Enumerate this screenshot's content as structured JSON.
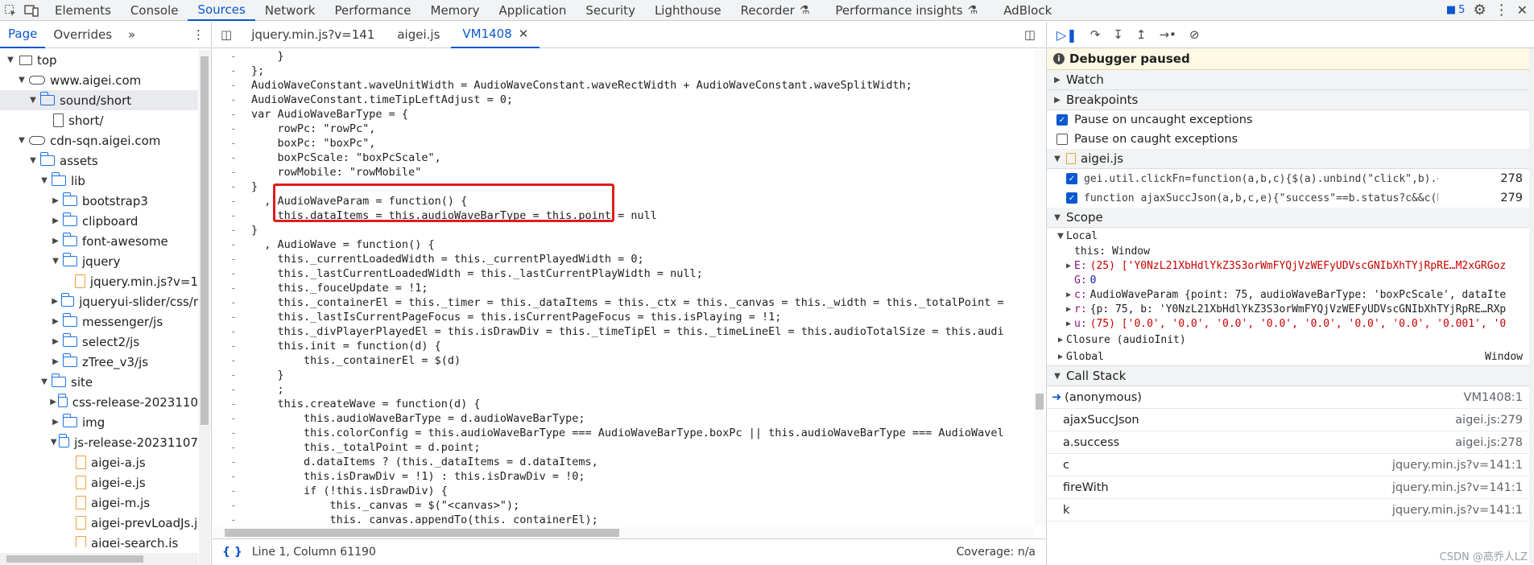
{
  "toolbar": {
    "tabs": [
      "Elements",
      "Console",
      "Sources",
      "Network",
      "Performance",
      "Memory",
      "Application",
      "Security",
      "Lighthouse",
      "Recorder",
      "Performance insights",
      "AdBlock"
    ],
    "active_tab": "Sources",
    "issues_count": "5"
  },
  "navigator": {
    "tabs": [
      "Page",
      "Overrides"
    ],
    "tree": [
      {
        "label": "top",
        "depth": 0,
        "type": "frame",
        "open": true
      },
      {
        "label": "www.aigei.com",
        "depth": 1,
        "type": "cloud",
        "open": true
      },
      {
        "label": "sound/short",
        "depth": 2,
        "type": "folder",
        "open": true,
        "selected": true
      },
      {
        "label": "short/",
        "depth": 3,
        "type": "file"
      },
      {
        "label": "cdn-sqn.aigei.com",
        "depth": 1,
        "type": "cloud",
        "open": true
      },
      {
        "label": "assets",
        "depth": 2,
        "type": "folder",
        "open": true
      },
      {
        "label": "lib",
        "depth": 3,
        "type": "folder",
        "open": true
      },
      {
        "label": "bootstrap3",
        "depth": 4,
        "type": "folder",
        "open": false
      },
      {
        "label": "clipboard",
        "depth": 4,
        "type": "folder",
        "open": false
      },
      {
        "label": "font-awesome",
        "depth": 4,
        "type": "folder",
        "open": false
      },
      {
        "label": "jquery",
        "depth": 4,
        "type": "folder",
        "open": true
      },
      {
        "label": "jquery.min.js?v=1",
        "depth": 5,
        "type": "jsfile"
      },
      {
        "label": "jqueryui-slider/css/r",
        "depth": 4,
        "type": "folder",
        "open": false
      },
      {
        "label": "messenger/js",
        "depth": 4,
        "type": "folder",
        "open": false
      },
      {
        "label": "select2/js",
        "depth": 4,
        "type": "folder",
        "open": false
      },
      {
        "label": "zTree_v3/js",
        "depth": 4,
        "type": "folder",
        "open": false
      },
      {
        "label": "site",
        "depth": 3,
        "type": "folder",
        "open": true
      },
      {
        "label": "css-release-2023110",
        "depth": 4,
        "type": "folder",
        "open": false
      },
      {
        "label": "img",
        "depth": 4,
        "type": "folder",
        "open": false
      },
      {
        "label": "js-release-20231107",
        "depth": 4,
        "type": "folder",
        "open": true
      },
      {
        "label": "aigei-a.js",
        "depth": 5,
        "type": "jsfile"
      },
      {
        "label": "aigei-e.js",
        "depth": 5,
        "type": "jsfile"
      },
      {
        "label": "aigei-m.js",
        "depth": 5,
        "type": "jsfile"
      },
      {
        "label": "aigei-prevLoadJs.j",
        "depth": 5,
        "type": "jsfile"
      },
      {
        "label": "aigei-search.js",
        "depth": 5,
        "type": "jsfile"
      }
    ]
  },
  "editor": {
    "tabs": [
      "jquery.min.js?v=141",
      "aigei.js",
      "VM1408"
    ],
    "active_tab": "VM1408",
    "lines": [
      "    }",
      "};",
      "AudioWaveConstant.waveUnitWidth = AudioWaveConstant.waveRectWidth + AudioWaveConstant.waveSplitWidth;",
      "AudioWaveConstant.timeTipLeftAdjust = 0;",
      "var AudioWaveBarType = {",
      "    rowPc: \"rowPc\",",
      "    boxPc: \"boxPc\",",
      "    boxPcScale: \"boxPcScale\",",
      "    rowMobile: \"rowMobile\"",
      "}",
      "  , AudioWaveParam = function() {",
      "    this.dataItems = this.audioWaveBarType = this.point = null",
      "}",
      "  , AudioWave = function() {",
      "    this._currentLoadedWidth = this._currentPlayedWidth = 0;",
      "    this._lastCurrentLoadedWidth = this._lastCurrentPlayWidth = null;",
      "    this._fouceUpdate = !1;",
      "    this._containerEl = this._timer = this._dataItems = this._ctx = this._canvas = this._width = this._totalPoint =",
      "    this._lastIsCurrentPageFocus = this.isCurrentPageFocus = this.isPlaying = !1;",
      "    this._divPlayerPlayedEl = this.isDrawDiv = this._timeTipEl = this._timeLineEl = this.audioTotalSize = this.audi",
      "    this.init = function(d) {",
      "        this._containerEl = $(d)",
      "    }",
      "    ;",
      "    this.createWave = function(d) {",
      "        this.audioWaveBarType = d.audioWaveBarType;",
      "        this.colorConfig = this.audioWaveBarType === AudioWaveBarType.boxPc || this.audioWaveBarType === AudioWavel",
      "        this._totalPoint = d.point;",
      "        d.dataItems ? (this._dataItems = d.dataItems,",
      "        this.isDrawDiv = !1) : this.isDrawDiv = !0;",
      "        if (!this.isDrawDiv) {",
      "            this._canvas = $(\"<canvas>\");",
      "            this._canvas.appendTo(this._containerEl);"
    ],
    "status_position": "Line 1, Column 61190",
    "coverage": "Coverage: n/a"
  },
  "debugger": {
    "paused_label": "Debugger paused",
    "sections": {
      "watch": "Watch",
      "breakpoints": "Breakpoints",
      "scope": "Scope",
      "call_stack": "Call Stack"
    },
    "pause_uncaught": "Pause on uncaught exceptions",
    "pause_caught": "Pause on caught exceptions",
    "bp_file": "aigei.js",
    "breakpoints": [
      {
        "code": "gei.util.clickFn=function(a,b,c){$(a).unbind(\"click\",b).cli…",
        "line": "278"
      },
      {
        "code": "function ajaxSuccJson(a,b,c,e){\"success\"==b.status?c&&c(b):…",
        "line": "279"
      }
    ],
    "scope": {
      "local_label": "Local",
      "this_row": "this: Window",
      "E_key": "E:",
      "E_val": "(25) ['Y0NzL21XbHdlYkZ3S3orWmFYQjVzWEFyUDVscGNIbXhTYjRpRE…M2xGRGoz",
      "G_key": "G:",
      "G_val": "0",
      "c_key": "c:",
      "c_val": "AudioWaveParam {point: 75, audioWaveBarType: 'boxPcScale', dataIte",
      "r_key": "r:",
      "r_val": "{p: 75, b: 'Y0NzL21XbHdlYkZ3S3orWmFYQjVzWEFyUDVscGNIbXhTYjRpRE…RXp",
      "u_key": "u:",
      "u_val": "(75) ['0.0', '0.0', '0.0', '0.0', '0.0', '0.0', '0.0', '0.001', '0",
      "closure": "Closure (audioInit)",
      "global": "Global",
      "global_val": "Window"
    },
    "call_stack": [
      {
        "name": "(anonymous)",
        "loc": "VM1408:1",
        "current": true
      },
      {
        "name": "ajaxSuccJson",
        "loc": "aigei.js:279"
      },
      {
        "name": "a.success",
        "loc": "aigei.js:278"
      },
      {
        "name": "c",
        "loc": "jquery.min.js?v=141:1"
      },
      {
        "name": "fireWith",
        "loc": "jquery.min.js?v=141:1"
      },
      {
        "name": "k",
        "loc": "jquery.min.js?v=141:1"
      }
    ],
    "watermark": "CSDN @高乔人LZ"
  },
  "colors": {
    "accent": "#0b57d0",
    "highlight": "#e01b1b",
    "paused_bg": "#fff8e5"
  }
}
